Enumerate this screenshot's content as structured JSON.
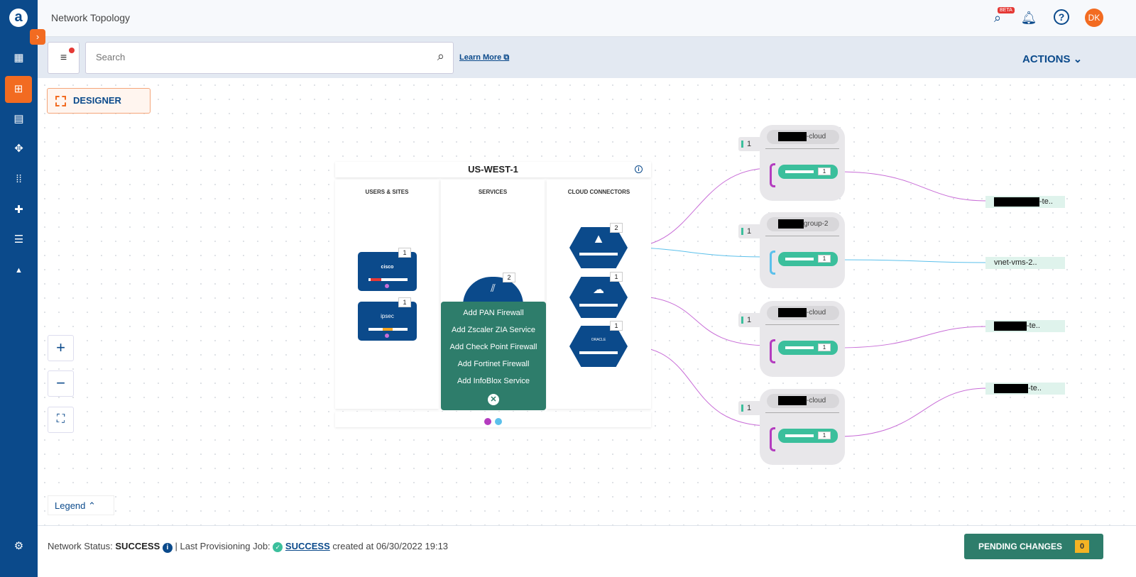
{
  "app": {
    "logo": "a",
    "title": "Network Topology",
    "beta": "BETA",
    "avatar": "DK"
  },
  "sidebar": {
    "items": [
      {
        "icon": "dashboard-icon",
        "glyph": "▦"
      },
      {
        "icon": "topology-icon",
        "glyph": "⊞"
      },
      {
        "icon": "document-icon",
        "glyph": "▤"
      },
      {
        "icon": "move-icon",
        "glyph": "✥"
      },
      {
        "icon": "apps-icon",
        "glyph": "⁞⁞"
      },
      {
        "icon": "puzzle-icon",
        "glyph": "✚"
      },
      {
        "icon": "sliders-icon",
        "glyph": "☰"
      },
      {
        "icon": "bell-icon",
        "glyph": "▲"
      },
      {
        "icon": "gear-icon",
        "glyph": "⚙"
      }
    ]
  },
  "toolbar": {
    "search_placeholder": "Search",
    "learn_more": "Learn More ⧉",
    "actions": "ACTIONS ⌄"
  },
  "canvas": {
    "designer": "DESIGNER",
    "legend": "Legend ⌃",
    "zoom_in": "+",
    "zoom_out": "−",
    "fit": "⛶"
  },
  "region": {
    "name": "US-WEST-1",
    "columns": [
      "USERS & SITES",
      "SERVICES",
      "CLOUD CONNECTORS"
    ],
    "sites": [
      {
        "label": "cisco",
        "count": "1",
        "bar_color": "#e53935"
      },
      {
        "label": "ipsec",
        "count": "1",
        "bar_color": "#f5a623"
      }
    ],
    "service": {
      "count": "2"
    },
    "connectors": [
      {
        "name": "azure",
        "count": "2"
      },
      {
        "name": "cloud",
        "count": "1"
      },
      {
        "name": "oracle",
        "count": "1",
        "label": "ORACLE"
      }
    ],
    "menu": [
      "Add PAN Firewall",
      "Add Zscaler ZIA Service",
      "Add Check Point Firewall",
      "Add Fortinet Firewall",
      "Add InfoBlox Service"
    ]
  },
  "groups": [
    {
      "name": "-cloud",
      "tag": "1",
      "count": "1",
      "color": "#b43cbf"
    },
    {
      "name": "group-2",
      "tag": "1",
      "count": "1",
      "color": "#5bc0eb"
    },
    {
      "name": "-cloud",
      "tag": "1",
      "count": "1",
      "color": "#b43cbf"
    },
    {
      "name": "-cloud",
      "tag": "1",
      "count": "1",
      "color": "#b43cbf"
    }
  ],
  "endpoints": [
    "-te..",
    "vnet-vms-2..",
    "-te..",
    "-te.."
  ],
  "footer": {
    "network_status_label": "Network Status:",
    "network_status": "SUCCESS",
    "job_label": "| Last Provisioning Job:",
    "job_status": "SUCCESS",
    "created": "created at 06/30/2022 19:13",
    "pending": "PENDING CHANGES",
    "pending_count": "0"
  },
  "colors": {
    "brand": "#0b4a8b",
    "accent": "#f26b21",
    "teal": "#2e7d6b",
    "green": "#3bbf9c",
    "magenta": "#b43cbf",
    "blue_link": "#5bc0eb"
  }
}
